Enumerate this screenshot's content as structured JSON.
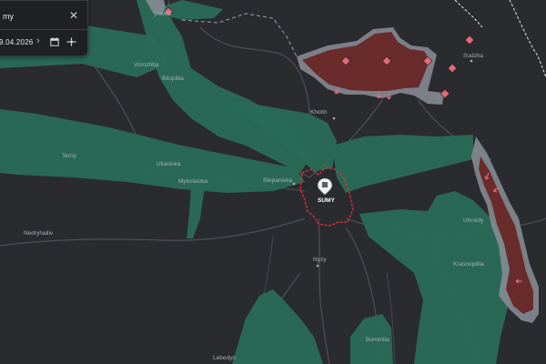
{
  "search": {
    "value": "my",
    "clear_icon": "close-icon"
  },
  "date": {
    "value": "9.04.2026",
    "calendar_icon": "calendar-icon",
    "timeline_icon": "timeline-icon"
  },
  "map": {
    "colors": {
      "background": "#2a2b2f",
      "control_zone": "#2a6b58",
      "occupied_zone": "#6a2b2b",
      "occupied_outline": "#8a8f99",
      "attack_marker": "#e06d79",
      "roads": "#5a5e66",
      "border": "#e8e8e8"
    },
    "places": {
      "yurivka": "yrovka",
      "vorozhba": "Vorozhba",
      "bilopillia": "Bilopillia",
      "khotin": "Khotin",
      "sudzha": "Sudzha",
      "terny": "Terny",
      "ulianivka": "Ulianivka",
      "mykolaivka": "Mykolaivka",
      "stepanivka": "Stepanivka",
      "sumy": "SUMY",
      "uhroidy": "Uhroidy",
      "nedryhailiv": "Nedryhailiv",
      "nyzy": "Nyzy",
      "krasnopillia": "Krasnopillia",
      "boromlia": "Boromlia",
      "lebedyn": "Lebedyn"
    }
  }
}
